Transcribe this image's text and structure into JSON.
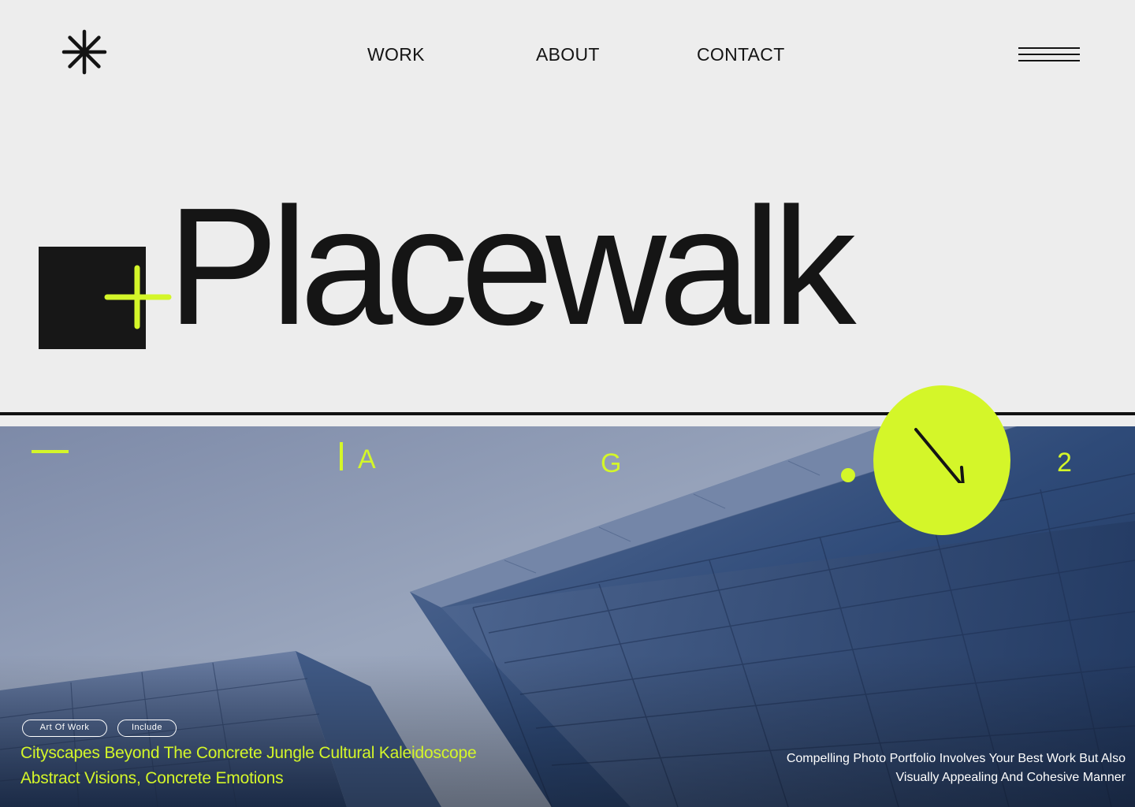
{
  "nav": {
    "logo_icon": "asterisk-icon",
    "links": [
      "WORK",
      "ABOUT",
      "CONTACT"
    ],
    "menu_icon": "hamburger-menu-icon"
  },
  "hero": {
    "title": "Placewalk",
    "plus_icon": "plus-icon"
  },
  "gallery": {
    "markers": [
      "A",
      "G"
    ],
    "page_number": "2",
    "scroll_icon": "arrow-down-right-icon",
    "tags": [
      "Art Of Work",
      "Include"
    ],
    "caption_lines": [
      "Cityscapes Beyond The Concrete Jungle Cultural Kaleidoscope",
      "Abstract Visions, Concrete Emotions"
    ],
    "description_lines": [
      "Compelling Photo Portfolio Involves  Your Best Work But Also",
      "Visually Appealing And Cohesive Manner"
    ]
  },
  "colors": {
    "accent": "#d4f629",
    "background": "#ededed",
    "ink": "#141414",
    "photo_sky": "#8e9bb5",
    "photo_glass": "#2f4b78"
  }
}
